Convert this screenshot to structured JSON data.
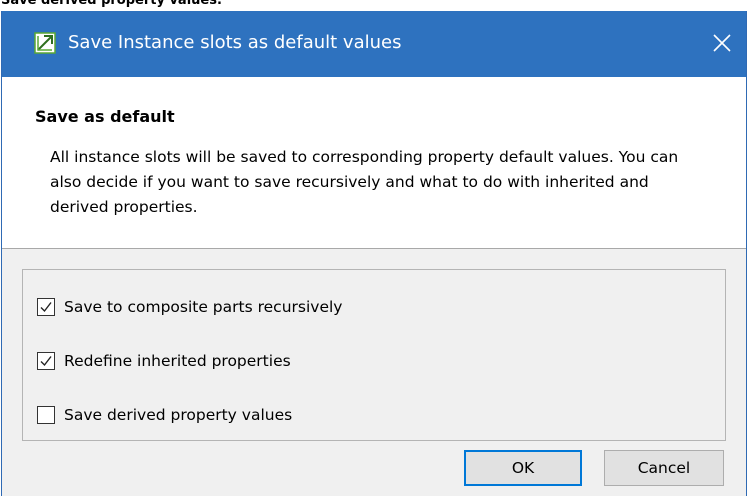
{
  "page_caption": "Save derived property values.",
  "dialog": {
    "title": "Save Instance slots as default values",
    "icon": "app-dialog-icon",
    "close_icon": "close-icon"
  },
  "header": {
    "title": "Save as default",
    "description": "All instance slots will be saved to corresponding property default values.  You can also decide if you want to save recursively and what to do with inherited and derived properties."
  },
  "options": [
    {
      "label": "Save to composite parts recursively",
      "checked": true
    },
    {
      "label": "Redefine inherited properties",
      "checked": true
    },
    {
      "label": "Save derived property values",
      "checked": false
    }
  ],
  "buttons": {
    "ok_label": "OK",
    "cancel_label": "Cancel"
  },
  "colors": {
    "titlebar": "#2e72bf",
    "default_button_border": "#0078d7",
    "icon_green": "#5aa834"
  }
}
